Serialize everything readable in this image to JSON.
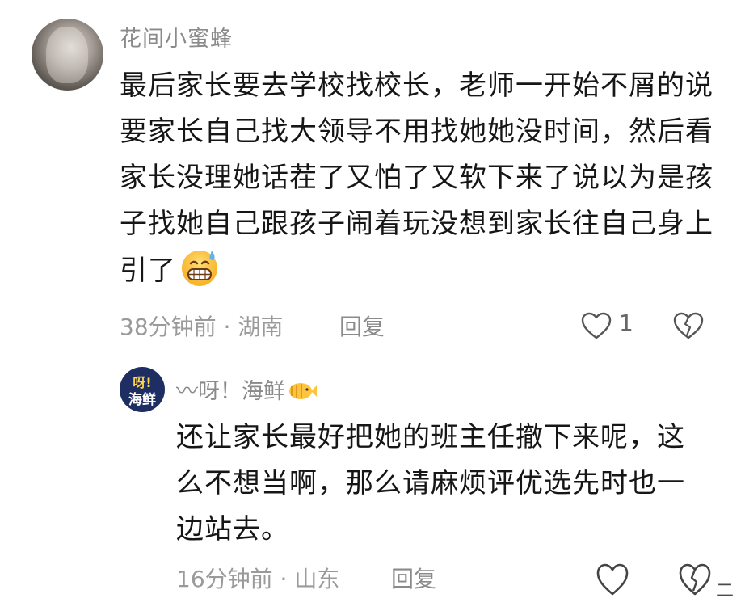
{
  "comment": {
    "username": "花间小蜜蜂",
    "text": "最后家长要去学校找校长，老师一开始不屑的说要家长自己找大领导不用找她她没时间，然后看家长没理她话茬了又怕了又软下来了说以为是孩子找她自己跟孩子闹着玩没想到家长往自己身上引了",
    "emoji": "grimacing-sweat-emoji",
    "time_location": "38分钟前 · 湖南",
    "reply_label": "回复",
    "like_count": "1",
    "icons": {
      "like": "heart-outline-icon",
      "dislike": "broken-heart-icon"
    }
  },
  "reply": {
    "avatar_line1": "呀!",
    "avatar_line2": "海鲜",
    "username": "〰呀！海鲜",
    "username_icon": "fish-icon",
    "text": "还让家长最好把她的班主任撤下来呢，这么不想当啊，那么请麻烦评优选先时也一边站去。",
    "time_location": "16分钟前 · 山东",
    "reply_label": "回复"
  },
  "watermark": "二",
  "colors": {
    "meta_gray": "#9a9a9a",
    "text": "#161616",
    "reply_avatar_bg": "#1e2e63",
    "reply_avatar_accent": "#ffd54a"
  }
}
